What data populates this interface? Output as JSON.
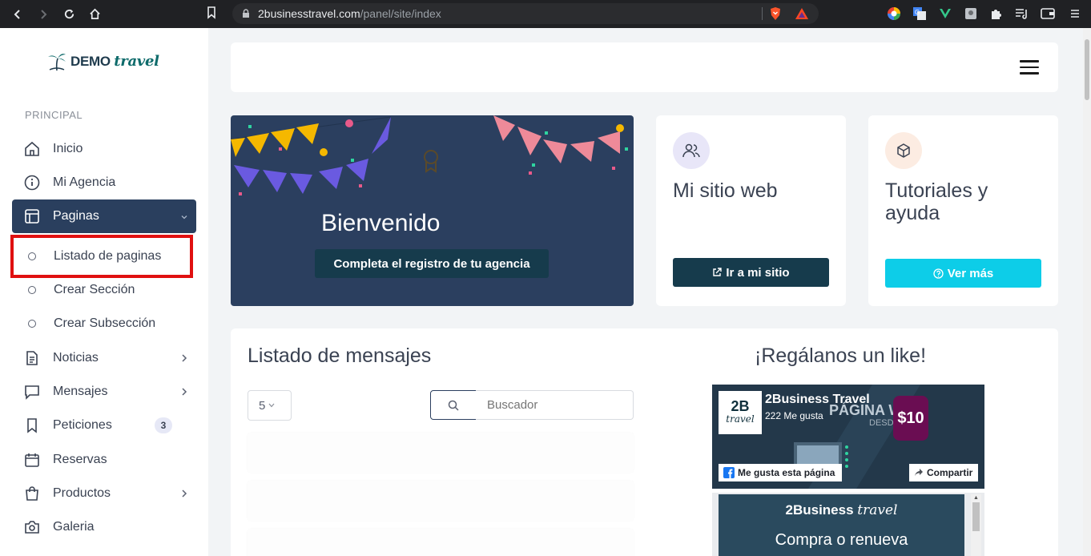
{
  "browser": {
    "url_host": "2businesstravel.com",
    "url_path": "/panel/site/index"
  },
  "sidebar": {
    "logo_main": "DEMO",
    "logo_accent": "travel",
    "section_label": "PRINCIPAL",
    "items": [
      {
        "label": "Inicio",
        "icon": "home-icon"
      },
      {
        "label": "Mi Agencia",
        "icon": "info-icon"
      },
      {
        "label": "Paginas",
        "icon": "layout-icon"
      },
      {
        "label": "Noticias",
        "icon": "document-icon"
      },
      {
        "label": "Mensajes",
        "icon": "message-icon"
      },
      {
        "label": "Peticiones",
        "icon": "bookmark-icon",
        "badge": "3"
      },
      {
        "label": "Reservas",
        "icon": "calendar-icon"
      },
      {
        "label": "Productos",
        "icon": "shopping-bag-icon"
      },
      {
        "label": "Galeria",
        "icon": "camera-icon"
      }
    ],
    "sub_items": [
      "Listado de paginas",
      "Crear Sección",
      "Crear Subsección"
    ]
  },
  "welcome": {
    "title": "Bienvenido",
    "button": "Completa el registro de tu agencia"
  },
  "cards": {
    "site": {
      "title": "Mi sitio web",
      "button": "Ir a mi sitio",
      "button_color": "#163b4c"
    },
    "help": {
      "title": "Tutoriales y ayuda",
      "button": "Ver más",
      "button_color": "#0dcde8"
    }
  },
  "messages": {
    "title": "Listado de mensajes",
    "page_size": "5",
    "search_placeholder": "Buscador"
  },
  "facebook": {
    "title": "¡Regálanos un like!",
    "page_name": "2Business Travel",
    "likes": "222 Me gusta",
    "logo_top": "2B",
    "logo_bottom": "travel",
    "like_button": "Me gusta esta página",
    "share_button": "Compartir",
    "cover_heading": "PÁGINA WEB",
    "cover_sub": "DESDE",
    "cover_price": "$10",
    "post_brand_main": "2Business",
    "post_brand_accent": "travel",
    "post_text": "Compra o renueva"
  },
  "colors": {
    "sidebar_active": "#2a3f5e",
    "highlight_border": "#e01010"
  }
}
